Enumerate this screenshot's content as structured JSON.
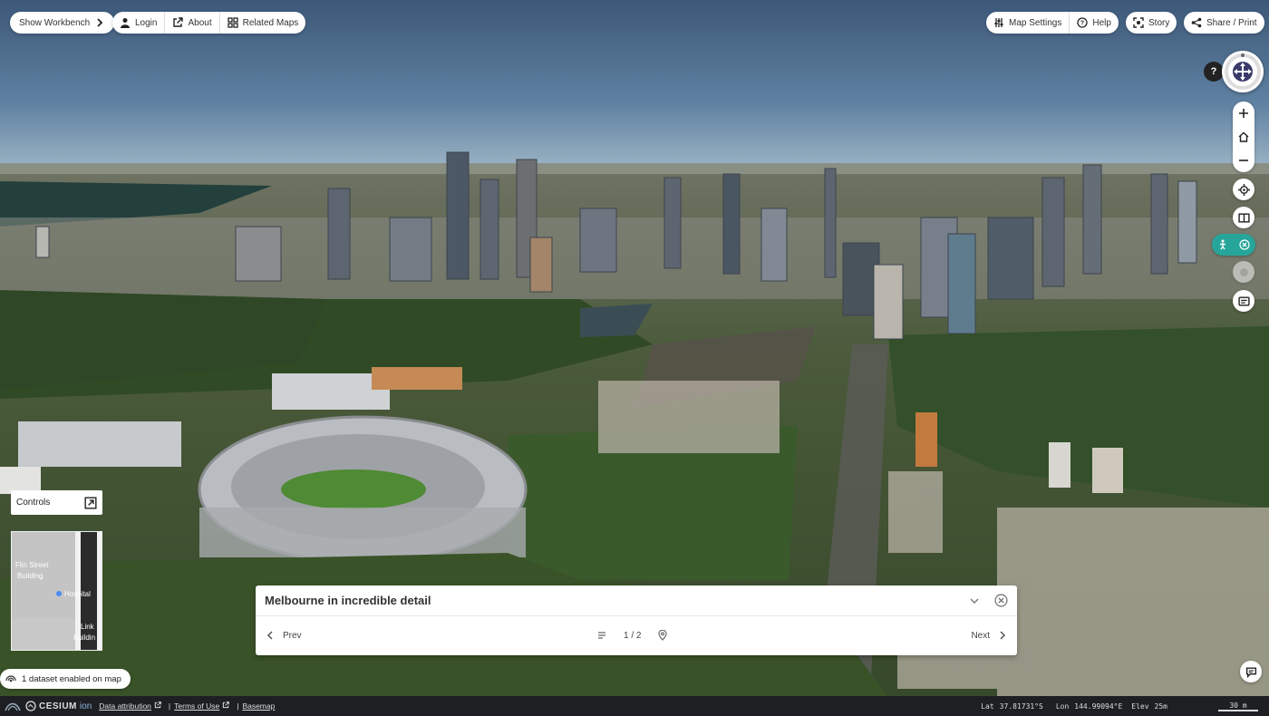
{
  "colors": {
    "accent": "#26a69a",
    "compass_ring": "#3a3a6a",
    "bottom_bar": "#1d1f22"
  },
  "top_left": {
    "workbench": "Show Workbench",
    "login": "Login",
    "about": "About",
    "related": "Related Maps"
  },
  "top_right": {
    "settings": "Map Settings",
    "help": "Help",
    "story": "Story",
    "share": "Share / Print"
  },
  "nav": {
    "help_badge": "?",
    "zoom_in": "+",
    "zoom_out": "−"
  },
  "controls": {
    "label": "Controls"
  },
  "minimap": {
    "labels": [
      "Flin Street",
      "Building",
      "Hospital",
      "Link",
      "Buildin"
    ]
  },
  "dataset_status": {
    "label": "1 dataset enabled on map"
  },
  "story": {
    "title": "Melbourne in incredible detail",
    "prev": "Prev",
    "next": "Next",
    "page": "1 / 2"
  },
  "footer": {
    "logo_text": "CESIUM",
    "logo_suffix": "ion",
    "attribution": "Data attribution",
    "terms": "Terms of Use",
    "basemap": "Basemap",
    "lat_label": "Lat",
    "lat": "37.81731°S",
    "lon_label": "Lon",
    "lon": "144.99094°E",
    "elev_label": "Elev",
    "elev": "25m",
    "scale": "30 m"
  }
}
